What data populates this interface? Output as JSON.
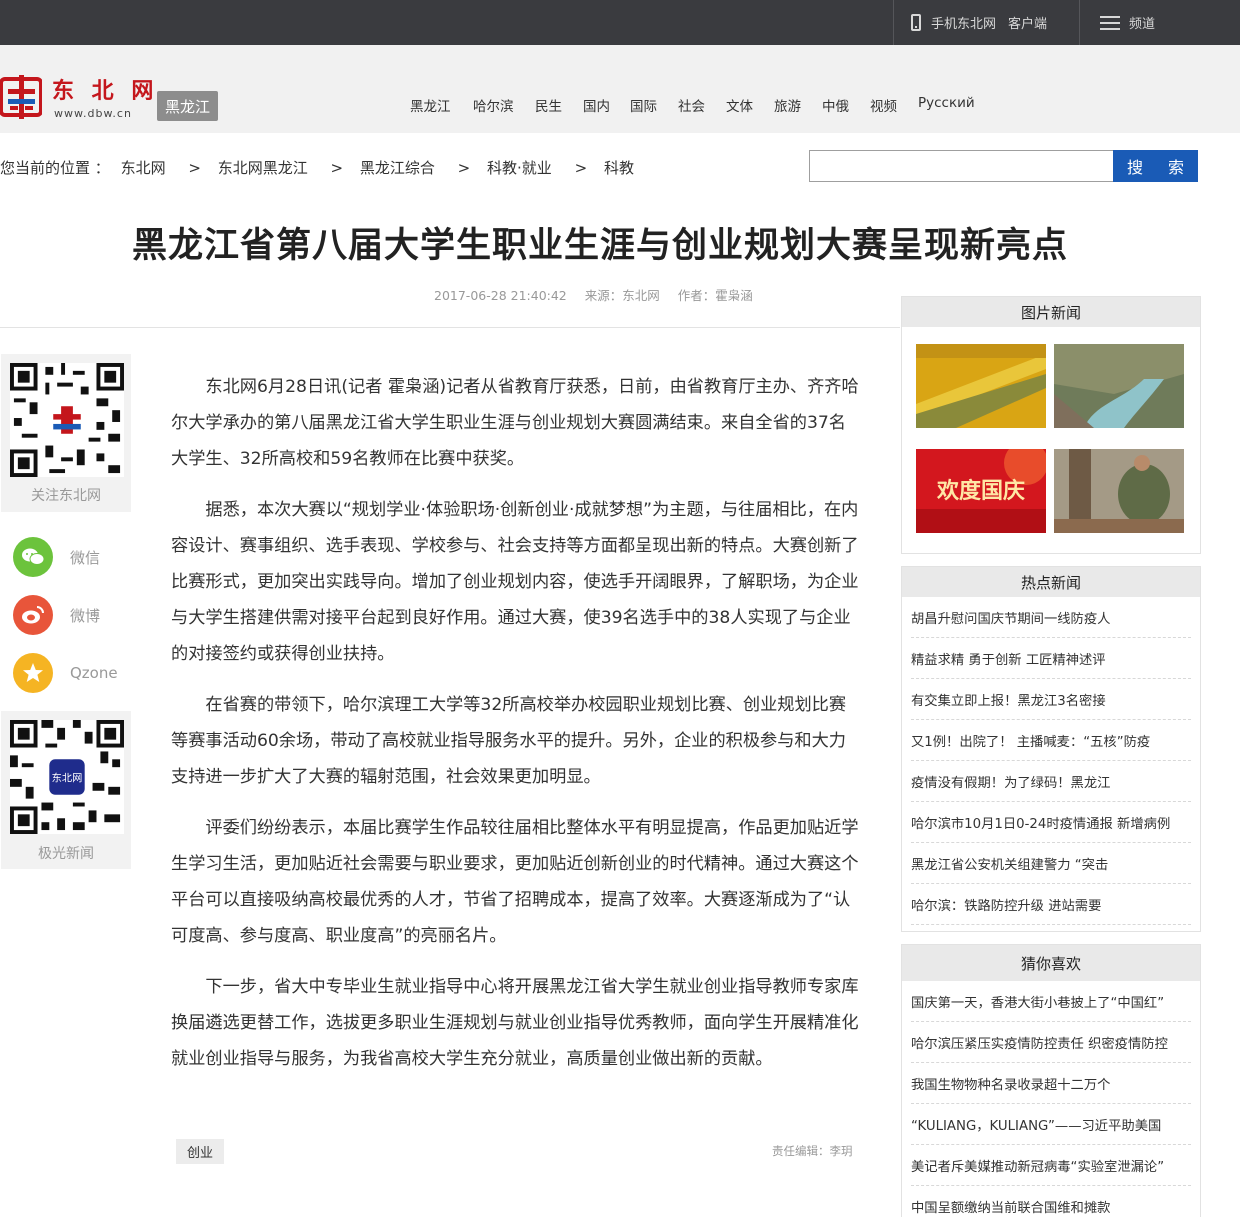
{
  "topbar": {
    "mobile_label": "手机东北网",
    "client_label": "客户端",
    "channel_label": "频道"
  },
  "brand": {
    "name_cn": "东 北 网",
    "url_text": "www.dbw.cn",
    "region_label": "黑龙江",
    "logo_color": "#c4161c"
  },
  "nav": {
    "items": [
      "黑龙江",
      "哈尔滨",
      "民生",
      "国内",
      "国际",
      "社会",
      "文体",
      "旅游",
      "中俄",
      "视频",
      "Русский"
    ]
  },
  "breadcrumb": {
    "prefix": "您当前的位置 ：",
    "items": [
      "东北网",
      "东北网黑龙江",
      "黑龙江综合",
      "科教·就业",
      "科教"
    ],
    "separator": ">"
  },
  "search": {
    "value": "",
    "button_label": "搜 索",
    "button_color": "#1a5bb6"
  },
  "article": {
    "title": "黑龙江省第八届大学生职业生涯与创业规划大赛呈现新亮点",
    "date": "2017-06-28 21:40:42",
    "source": "来源：东北网",
    "author": "作者：霍枭涵",
    "paragraphs": [
      "东北网6月28日讯(记者 霍枭涵)记者从省教育厅获悉，日前，由省教育厅主办、齐齐哈尔大学承办的第八届黑龙江省大学生职业生涯与创业规划大赛圆满结束。来自全省的37名大学生、32所高校和59名教师在比赛中获奖。",
      "据悉，本次大赛以“规划学业·体验职场·创新创业·成就梦想”为主题，与往届相比，在内容设计、赛事组织、选手表现、学校参与、社会支持等方面都呈现出新的特点。大赛创新了比赛形式，更加突出实践导向。增加了创业规划内容，使选手开阔眼界，了解职场，为企业与大学生搭建供需对接平台起到良好作用。通过大赛，使39名选手中的38人实现了与企业的对接签约或获得创业扶持。",
      "在省赛的带领下，哈尔滨理工大学等32所高校举办校园职业规划比赛、创业规划比赛等赛事活动60余场，带动了高校就业指导服务水平的提升。另外，企业的积极参与和大力支持进一步扩大了大赛的辐射范围，社会效果更加明显。",
      "评委们纷纷表示，本届比赛学生作品较往届相比整体水平有明显提高，作品更加贴近学生学习生活，更加贴近社会需要与职业要求，更加贴近创新创业的时代精神。通过大赛这个平台可以直接吸纳高校最优秀的人才，节省了招聘成本，提高了效率。大赛逐渐成为了“认可度高、参与度高、职业度高”的亮丽名片。",
      "下一步，省大中专毕业生就业指导中心将开展黑龙江省大学生就业创业指导教师专家库换届遴选更替工作，选拔更多职业生涯规划与就业创业指导优秀教师，面向学生开展精准化就业创业指导与服务，为我省高校大学生充分就业，高质量创业做出新的贡献。"
    ],
    "tag": "创业",
    "editor": "责任编辑：李玥"
  },
  "share": {
    "follow_label": "关注东北网",
    "wechat_label": "微信",
    "weibo_label": "微博",
    "qzone_label": "Qzone",
    "jiguang_label": "极光新闻",
    "qr_logo_text": "东北网",
    "colors": {
      "wechat": "#6cc33c",
      "weibo": "#e8553a",
      "qzone": "#f5b423"
    }
  },
  "sidebar": {
    "photo_news_title": "图片新闻",
    "photo_banner_text": "欢度国庆",
    "hot_news_title": "热点新闻",
    "hot_news": [
      "胡昌升慰问国庆节期间一线防疫人",
      "精益求精 勇于创新 工匠精神述评",
      "有交集立即上报！黑龙江3名密接",
      "又1例！出院了！ 主播喊麦：“五核”防疫",
      "疫情没有假期！为了绿码！黑龙江",
      "哈尔滨市10月1日0-24时疫情通报 新增病例",
      "黑龙江省公安机关组建警力 “突击",
      "哈尔滨：铁路防控升级 进站需要"
    ],
    "guess_title": "猜你喜欢",
    "guess_news": [
      "国庆第一天，香港大街小巷披上了“中国红”",
      "哈尔滨压紧压实疫情防控责任 织密疫情防控",
      "我国生物物种名录收录超十二万个",
      "“KULIANG，KULIANG”——习近平助美国",
      "美记者斥美媒推动新冠病毒“实验室泄漏论”",
      "中国呈额缴纳当前联合国维和摊款"
    ]
  }
}
